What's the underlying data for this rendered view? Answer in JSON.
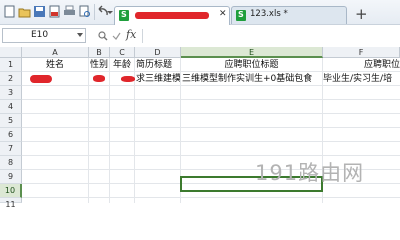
{
  "tabs": [
    {
      "label": "",
      "active": true,
      "redacted": true
    },
    {
      "label": "123.xls *",
      "active": false
    }
  ],
  "formula_bar": {
    "name_box": "E10",
    "fx": "fx",
    "content": ""
  },
  "columns": [
    "A",
    "B",
    "C",
    "D",
    "E",
    "F"
  ],
  "selected_column": "E",
  "rows": [
    "1",
    "2",
    "3",
    "4",
    "5",
    "6",
    "7",
    "8",
    "9",
    "10",
    "11"
  ],
  "selected_row": "10",
  "row1": {
    "A": "姓名",
    "B": "性别",
    "C": "年龄",
    "D": "简历标题",
    "E": "应聘职位标题",
    "F": "应聘职位"
  },
  "row2": {
    "D": "求三维建模",
    "E": "三维模型制作实训生+0基础包食",
    "F": "毕业生/实习生/培"
  },
  "watermark": "191路由网",
  "colors": {
    "redaction": "#e0262b",
    "selection": "#3c7a2e"
  }
}
